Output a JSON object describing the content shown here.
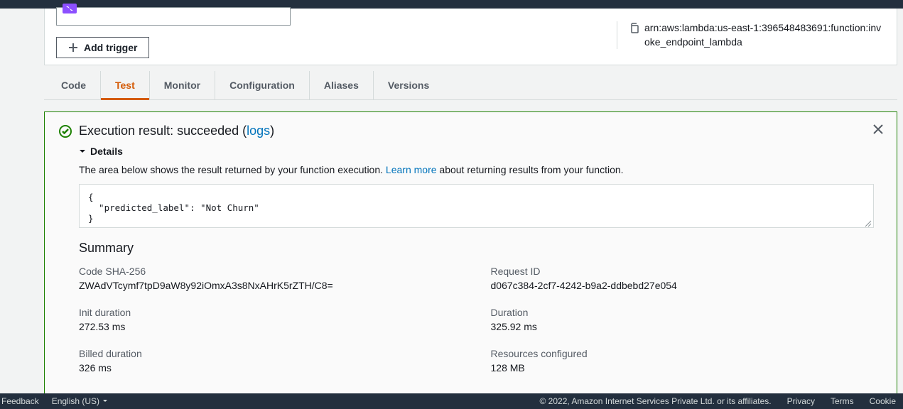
{
  "header": {
    "arn": "arn:aws:lambda:us-east-1:396548483691:function:invoke_endpoint_lambda",
    "add_trigger_label": "Add trigger"
  },
  "tabs": {
    "code": "Code",
    "test": "Test",
    "monitor": "Monitor",
    "configuration": "Configuration",
    "aliases": "Aliases",
    "versions": "Versions"
  },
  "result": {
    "title_prefix": "Execution result: succeeded (",
    "logs_link": "logs",
    "title_suffix": ")",
    "details_label": "Details",
    "intro_before": "The area below shows the result returned by your function execution. ",
    "learn_more": "Learn more",
    "intro_after": " about returning results from your function.",
    "output": "{\n  \"predicted_label\": \"Not Churn\"\n}",
    "summary_title": "Summary",
    "summary": {
      "code_sha_label": "Code SHA-256",
      "code_sha_value": "ZWAdVTcymf7tpD9aW8y92iOmxA3s8NxAHrK5rZTH/C8=",
      "request_id_label": "Request ID",
      "request_id_value": "d067c384-2cf7-4242-b9a2-ddbebd27e054",
      "init_duration_label": "Init duration",
      "init_duration_value": "272.53 ms",
      "duration_label": "Duration",
      "duration_value": "325.92 ms",
      "billed_label": "Billed duration",
      "billed_value": "326 ms",
      "resources_label": "Resources configured",
      "resources_value": "128 MB"
    }
  },
  "footer": {
    "feedback": "Feedback",
    "language": "English (US)",
    "copyright": "© 2022, Amazon Internet Services Private Ltd. or its affiliates.",
    "privacy": "Privacy",
    "terms": "Terms",
    "cookie": "Cookie"
  }
}
